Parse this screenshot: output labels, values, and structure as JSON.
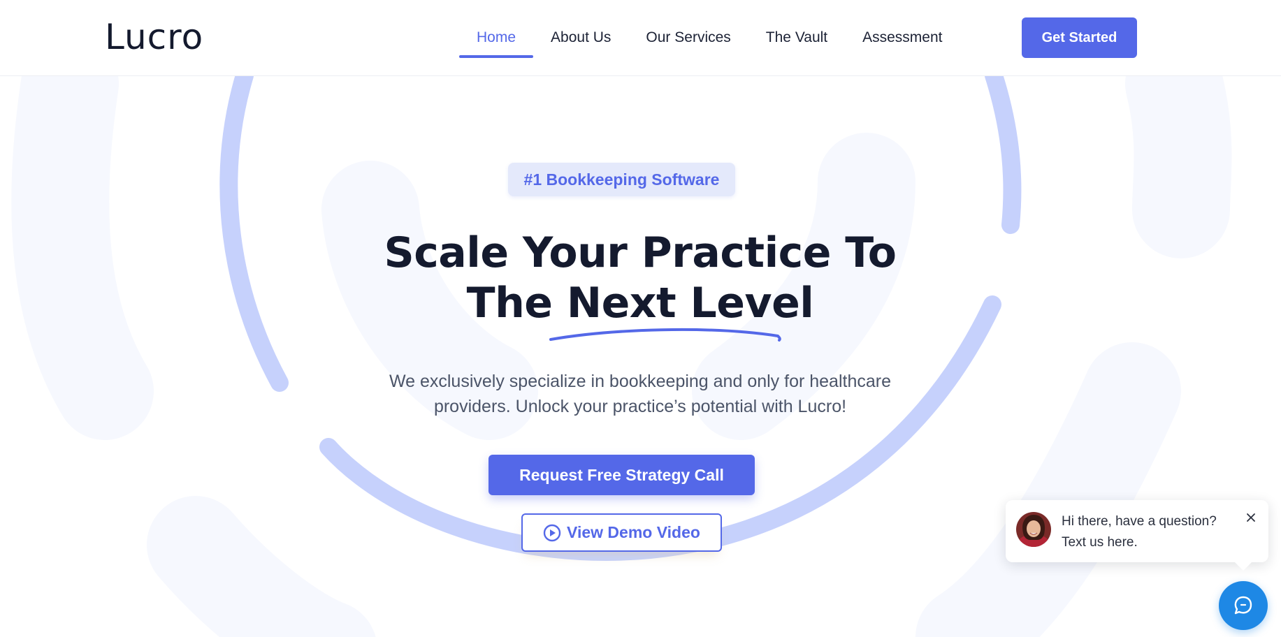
{
  "header": {
    "logo": "Lucro",
    "nav": [
      {
        "label": "Home",
        "active": true
      },
      {
        "label": "About Us",
        "active": false
      },
      {
        "label": "Our Services",
        "active": false
      },
      {
        "label": "The Vault",
        "active": false
      },
      {
        "label": "Assessment",
        "active": false
      }
    ],
    "cta_label": "Get Started"
  },
  "hero": {
    "badge": "#1 Bookkeeping Software",
    "title_line1": "Scale Your Practice To",
    "title_line2_plain": "The ",
    "title_line2_highlight": "Next Level",
    "subtitle_line1": "We exclusively specialize in bookkeeping and only for healthcare",
    "subtitle_line2": "providers. Unlock your practice’s potential with Lucro!",
    "primary_cta": "Request Free Strategy Call",
    "secondary_cta": "View Demo Video"
  },
  "chat": {
    "message_line1": "Hi there, have a question?",
    "message_line2": "Text us here."
  },
  "colors": {
    "accent": "#5468e8",
    "dark_text": "#141a2e",
    "badge_bg": "#e4e9fb",
    "decor_ring": "#c6d1fc",
    "decor_soft": "#f6f8fe",
    "chat_launcher": "#1e88e5"
  },
  "icons": {
    "demo": "play-circle-icon",
    "chat_close": "close-icon",
    "chat_launcher": "chat-bubble-icon"
  }
}
